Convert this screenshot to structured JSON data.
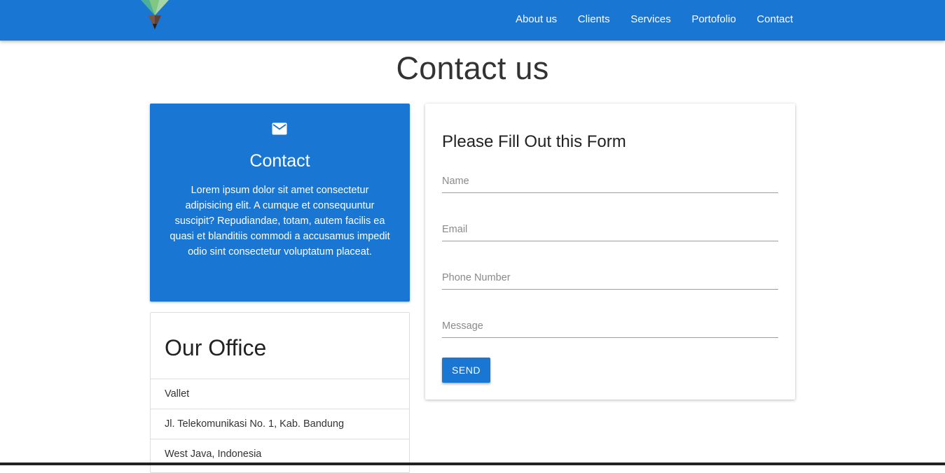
{
  "nav": {
    "logo_icon": "brand-logo-icon",
    "links": [
      "About us",
      "Clients",
      "Services",
      "Portofolio",
      "Contact"
    ]
  },
  "page": {
    "title": "Contact us"
  },
  "contact_card": {
    "icon": "envelope-icon",
    "title": "Contact",
    "text": "Lorem ipsum dolor sit amet consectetur adipisicing elit. A cumque et consequuntur suscipit? Repudiandae, totam, autem facilis ea quasi et blanditiis commodi a accusamus impedit odio sint consectetur voluptatum placeat."
  },
  "office": {
    "title": "Our Office",
    "lines": [
      "Vallet",
      "Jl. Telekomunikasi No. 1, Kab. Bandung",
      "West Java, Indonesia"
    ]
  },
  "form": {
    "title": "Please Fill Out this Form",
    "name_placeholder": "Name",
    "email_placeholder": "Email",
    "phone_placeholder": "Phone Number",
    "message_placeholder": "Message",
    "send_label": "SEND"
  },
  "colors": {
    "primary": "#1976d2",
    "text": "#222222",
    "divider": "#dddddd"
  }
}
